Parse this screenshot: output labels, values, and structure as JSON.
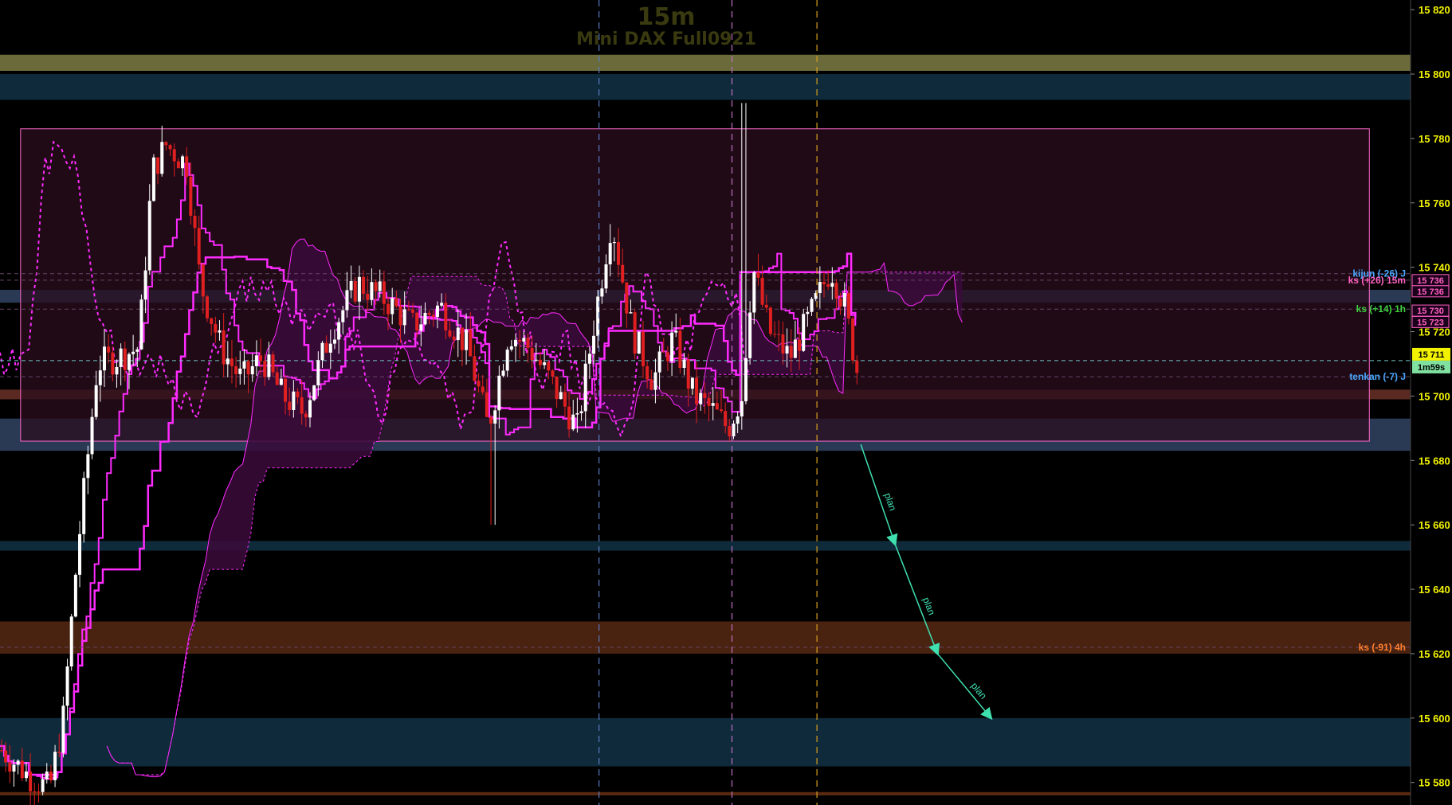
{
  "title": {
    "timeframe": "15m",
    "instrument": "Mini DAX Full0921"
  },
  "colors": {
    "background": "#000000",
    "axis_text": "#f2f200",
    "candle_up": "#ffffff",
    "candle_down": "#e02020",
    "ichimoku_magenta": "#ff2bff",
    "cloud_fill": "#3a0a3a",
    "range_box_fill": "#2a0e1e",
    "range_box_stroke": "#ff66cc",
    "plan_arrow": "#3fe0b0",
    "tenkan_label": "#4aa8ff",
    "ks_1h_label": "#40d040",
    "ks_4h_label": "#ff8030",
    "ks_15m_label": "#ff60c0",
    "kijun_label": "#4aa8ff"
  },
  "chart_data": {
    "type": "candlestick",
    "ylim": [
      15573,
      15823
    ],
    "y_ticks": [
      15820,
      15800,
      15780,
      15760,
      15740,
      15720,
      15700,
      15680,
      15660,
      15640,
      15620,
      15600,
      15580
    ],
    "y_tick_labels": [
      "15 820",
      "15 800",
      "15 780",
      "15 760",
      "15 740",
      "15 720",
      "15 700",
      "15 680",
      "15 660",
      "15 640",
      "15 620",
      "15 600",
      "15 580"
    ],
    "current_price": 15711,
    "current_price_label": "15 711",
    "countdown_label": "1m59s",
    "price_tags": [
      {
        "value": 15736,
        "label": "15 736",
        "color": "#ff60c0"
      },
      {
        "value": 15736,
        "label": "15 736",
        "color": "#ff60c0"
      },
      {
        "value": 15730,
        "label": "15 730",
        "color": "#ff60c0"
      },
      {
        "value": 15723,
        "label": "15 723",
        "color": "#ff60c0"
      }
    ],
    "level_labels": [
      {
        "text": "kijun (-26) J",
        "value": 15738,
        "color": "#4aa8ff"
      },
      {
        "text": "ks (+26) 15m",
        "value": 15736,
        "color": "#ff60c0"
      },
      {
        "text": "ks (+14) 1h",
        "value": 15727,
        "color": "#40d040"
      },
      {
        "text": "tenkan (-7) J",
        "value": 15706,
        "color": "#4aa8ff"
      },
      {
        "text": "ks (-91) 4h",
        "value": 15622,
        "color": "#ff8030"
      }
    ],
    "zones": [
      {
        "from": 15801,
        "to": 15806,
        "color": "#6a6a3a"
      },
      {
        "from": 15792,
        "to": 15800,
        "color": "#0f2a3a"
      },
      {
        "from": 15729,
        "to": 15733,
        "color": "#2a3a55"
      },
      {
        "from": 15699,
        "to": 15702,
        "color": "#5a2a22"
      },
      {
        "from": 15683,
        "to": 15693,
        "color": "#2a3a55"
      },
      {
        "from": 15652,
        "to": 15655,
        "color": "#0f2a3a"
      },
      {
        "from": 15620,
        "to": 15630,
        "color": "#4a2210"
      },
      {
        "from": 15585,
        "to": 15600,
        "color": "#0f2a3a"
      },
      {
        "from": 15576,
        "to": 15577,
        "color": "#5a2a10"
      }
    ],
    "range_box": {
      "x_start": 15,
      "x_end": 999,
      "top": 15783,
      "bottom": 15686
    },
    "plan_labels": [
      "plan",
      "plan",
      "plan"
    ],
    "plan_path": [
      {
        "bar": 628,
        "price": 15685
      },
      {
        "bar": 653,
        "price": 15654
      },
      {
        "bar": 684,
        "price": 15620
      },
      {
        "bar": 723,
        "price": 15600
      }
    ],
    "vlines": [
      {
        "bar": 437,
        "color": "#5a7abf"
      },
      {
        "bar": 534,
        "color": "#c070c0"
      },
      {
        "bar": 596,
        "color": "#d8a020"
      }
    ]
  }
}
